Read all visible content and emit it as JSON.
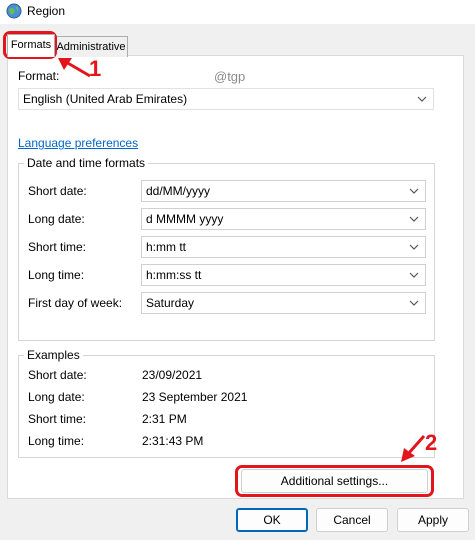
{
  "window": {
    "title": "Region"
  },
  "tabs": [
    {
      "label": "Formats"
    },
    {
      "label": "Administrative"
    }
  ],
  "formats": {
    "format_label": "Format:",
    "format_value": "English (United Arab Emirates)",
    "watermark": "@tgp",
    "language_link": "Language preferences",
    "date_time_group": {
      "title": "Date and time formats",
      "rows": [
        {
          "label": "Short date:",
          "value": "dd/MM/yyyy"
        },
        {
          "label": "Long date:",
          "value": "d MMMM yyyy"
        },
        {
          "label": "Short time:",
          "value": "h:mm tt"
        },
        {
          "label": "Long time:",
          "value": "h:mm:ss tt"
        },
        {
          "label": "First day of week:",
          "value": "Saturday"
        }
      ]
    },
    "examples_group": {
      "title": "Examples",
      "rows": [
        {
          "label": "Short date:",
          "value": "23/09/2021"
        },
        {
          "label": "Long date:",
          "value": "23 September 2021"
        },
        {
          "label": "Short time:",
          "value": "2:31 PM"
        },
        {
          "label": "Long time:",
          "value": "2:31:43 PM"
        }
      ]
    },
    "additional_settings": "Additional settings..."
  },
  "buttons": {
    "ok": "OK",
    "cancel": "Cancel",
    "apply": "Apply"
  },
  "annotations": {
    "step1": "1",
    "step2": "2",
    "color": "#e2151d"
  },
  "icons": [
    "globe-icon",
    "chevron-down-icon",
    "red-arrow-icon"
  ]
}
